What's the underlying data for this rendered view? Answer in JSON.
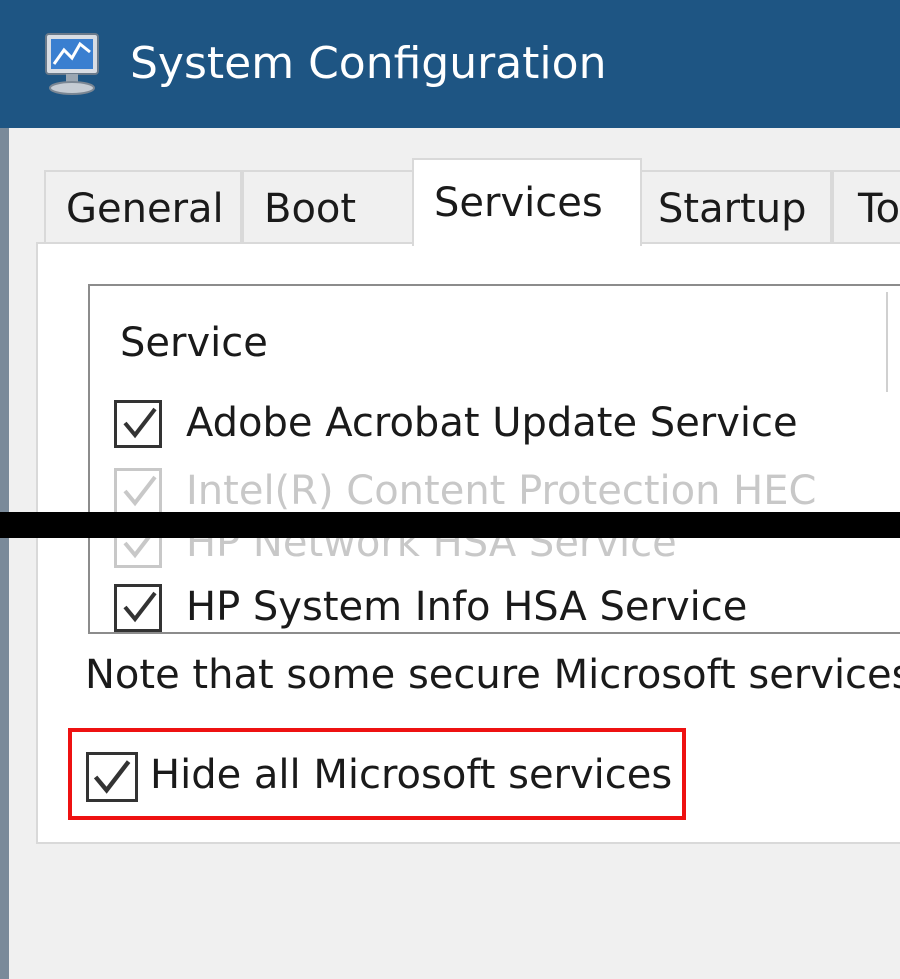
{
  "window": {
    "title": "System Configuration",
    "icon": "system-config-monitor-icon"
  },
  "tabs": [
    {
      "label": "General",
      "active": false
    },
    {
      "label": "Boot",
      "active": false
    },
    {
      "label": "Services",
      "active": true
    },
    {
      "label": "Startup",
      "active": false
    },
    {
      "label": "To",
      "active": false
    }
  ],
  "services": {
    "column_header": "Service",
    "rows": [
      {
        "name": "Adobe Acrobat Update Service",
        "checked": true,
        "faded": false
      },
      {
        "name": "Intel(R) Content Protection HEC",
        "checked": true,
        "faded": true
      },
      {
        "name": "HP Network HSA Service",
        "checked": true,
        "faded": true
      },
      {
        "name": "HP System Info HSA Service",
        "checked": true,
        "faded": false
      }
    ]
  },
  "note_text": "Note that some secure Microsoft services",
  "hide_microsoft": {
    "label": "Hide all Microsoft services",
    "checked": true,
    "highlight_color": "#ee1111"
  },
  "colors": {
    "titlebar": "#1e5583",
    "highlight": "#ee1111"
  }
}
